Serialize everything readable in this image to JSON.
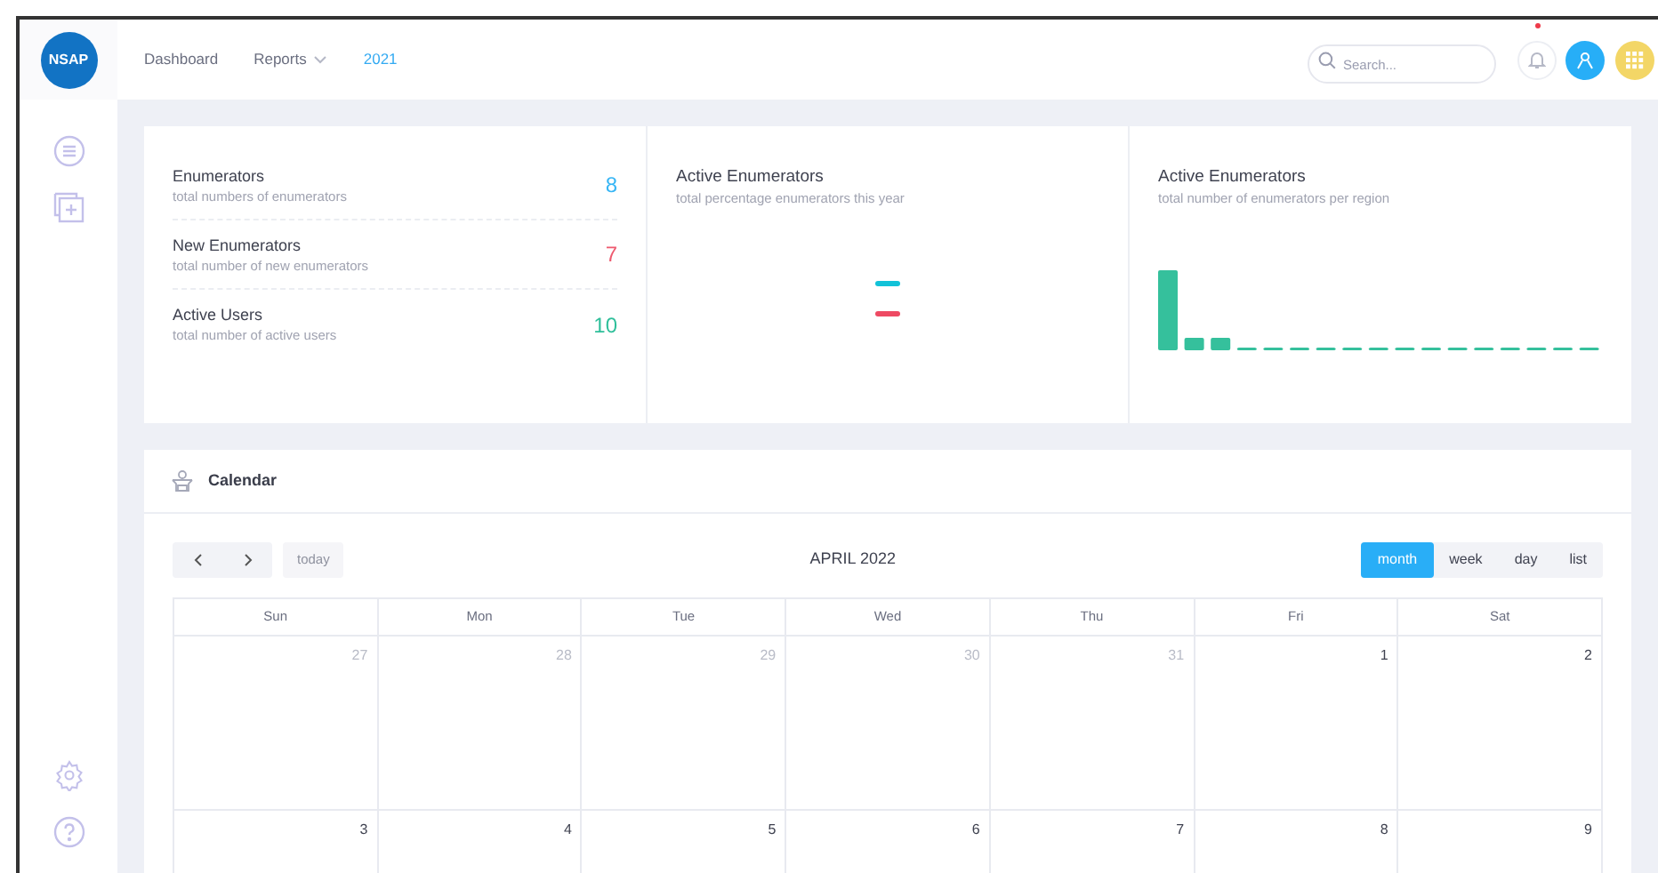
{
  "logo": "NSAP",
  "nav": [
    {
      "label": "Dashboard",
      "selected": false,
      "dropdown": false
    },
    {
      "label": "Reports",
      "selected": false,
      "dropdown": true
    },
    {
      "label": "2021",
      "selected": true,
      "dropdown": false
    }
  ],
  "search": {
    "placeholder": "Search..."
  },
  "notifications": {
    "unread": true
  },
  "stats": [
    {
      "title": "Enumerators",
      "subtitle": "total numbers of enumerators",
      "value": "8",
      "color": "#38b6f5"
    },
    {
      "title": "New Enumerators",
      "subtitle": "total number of new enumerators",
      "value": "7",
      "color": "#ee5a6f"
    },
    {
      "title": "Active Users",
      "subtitle": "total number of active users",
      "value": "10",
      "color": "#2fbf9a"
    }
  ],
  "panels": [
    {
      "title": "Active Enumerators",
      "subtitle": "total percentage enumerators this year",
      "kind": "dashes"
    },
    {
      "title": "Active Enumerators",
      "subtitle": "total number of enumerators per region",
      "kind": "bars"
    }
  ],
  "calendar": {
    "title": "Calendar",
    "today_button": {
      "label": "today",
      "disabled": true
    },
    "month": "APRIL 2022",
    "views": [
      {
        "label": "month",
        "selected": true
      },
      {
        "label": "week",
        "selected": false
      },
      {
        "label": "day",
        "selected": false
      },
      {
        "label": "list",
        "selected": false
      }
    ],
    "weekdays": [
      "Sun",
      "Mon",
      "Tue",
      "Wed",
      "Thu",
      "Fri",
      "Sat"
    ],
    "weeks": [
      [
        {
          "date": "27",
          "other_month": true
        },
        {
          "date": "28",
          "other_month": true
        },
        {
          "date": "29",
          "other_month": true
        },
        {
          "date": "30",
          "other_month": true
        },
        {
          "date": "31",
          "other_month": true
        },
        {
          "date": "1",
          "other_month": false
        },
        {
          "date": "2",
          "other_month": false
        }
      ],
      [
        {
          "date": "3",
          "other_month": false
        },
        {
          "date": "4",
          "other_month": false
        },
        {
          "date": "5",
          "other_month": false
        },
        {
          "date": "6",
          "other_month": false
        },
        {
          "date": "7",
          "other_month": false
        },
        {
          "date": "8",
          "other_month": false
        },
        {
          "date": "9",
          "other_month": false
        }
      ]
    ]
  }
}
